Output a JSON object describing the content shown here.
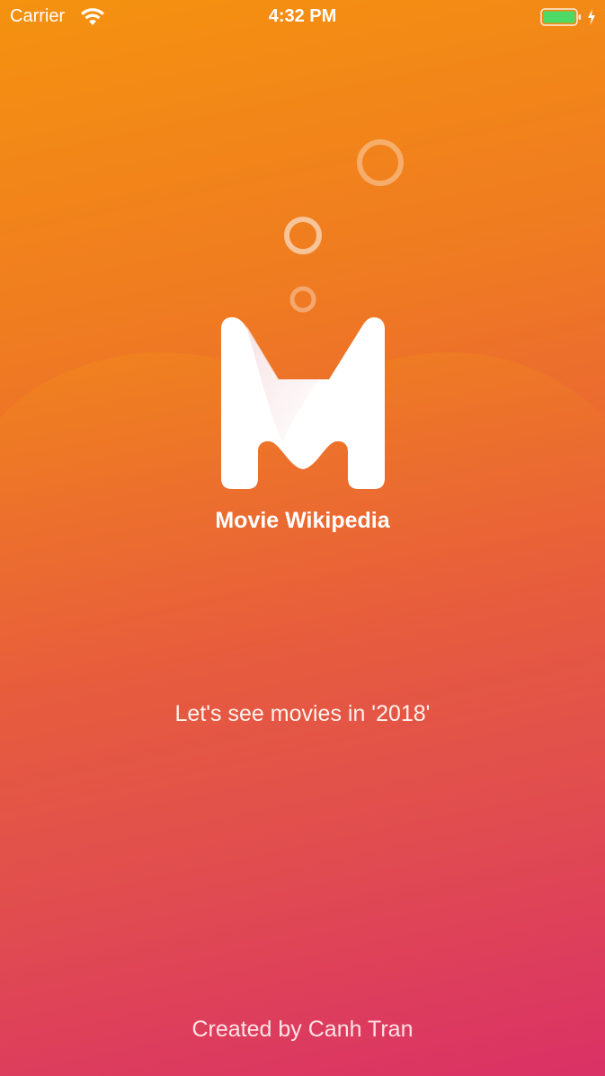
{
  "status_bar": {
    "carrier": "Carrier",
    "time": "4:32 PM",
    "icons": [
      "wifi-icon",
      "battery-icon",
      "charging-bolt-icon"
    ],
    "battery_level": 1.0
  },
  "splash": {
    "app_title": "Movie Wikipedia",
    "tagline": "Let's see movies in '2018'",
    "credit": "Created by Canh Tran",
    "logo_icon": "movie-m-logo-icon"
  },
  "colors": {
    "gradient_top": "#f5920f",
    "gradient_bottom": "#da3166",
    "text": "#ffffff",
    "battery_fill": "#4cd964"
  }
}
